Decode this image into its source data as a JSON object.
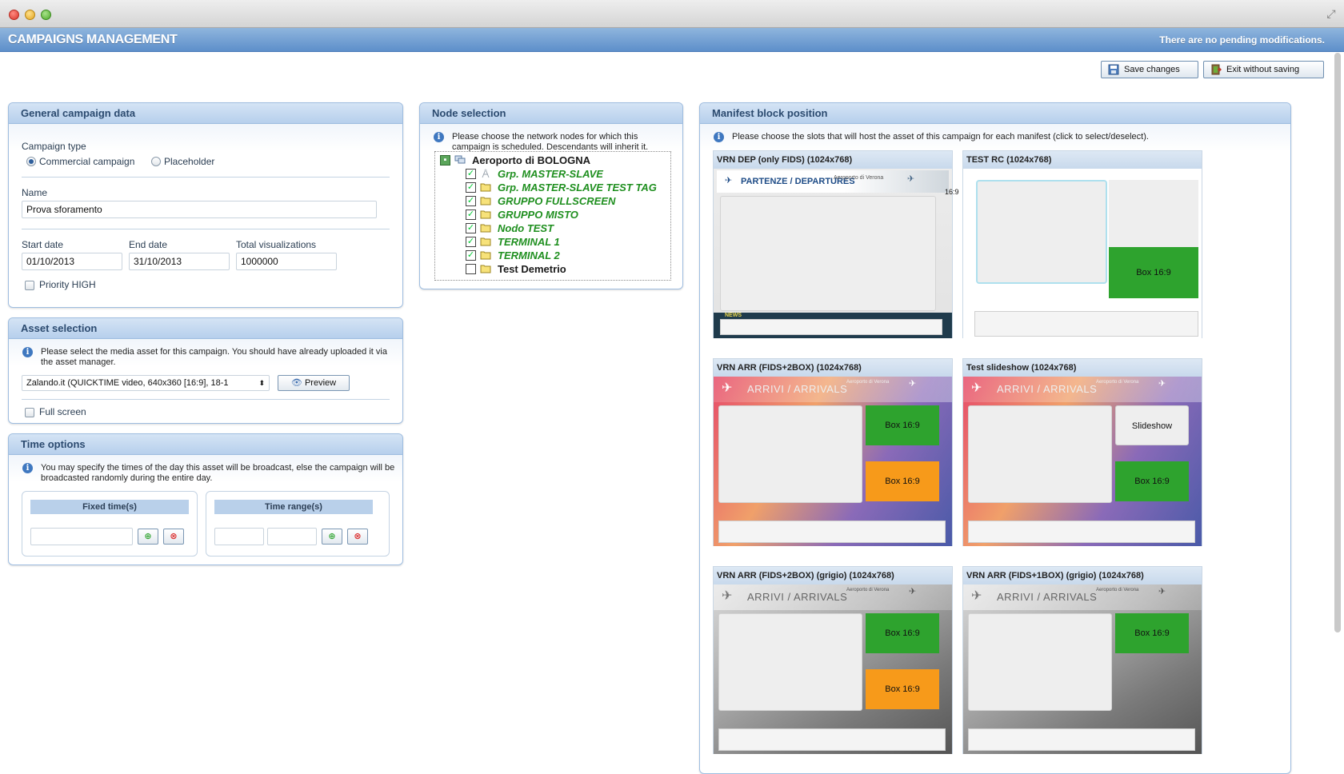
{
  "app": {
    "title": "CAMPAIGNS MANAGEMENT",
    "status": "There are no pending modifications.",
    "save_label": "Save changes",
    "exit_label": "Exit without saving"
  },
  "general": {
    "header": "General campaign data",
    "campaign_type_label": "Campaign type",
    "type_options": [
      "Commercial campaign",
      "Placeholder"
    ],
    "selected_type": "Commercial campaign",
    "name_label": "Name",
    "name_value": "Prova sforamento",
    "start_label": "Start date",
    "start_value": "01/10/2013",
    "end_label": "End date",
    "end_value": "31/10/2013",
    "total_label": "Total visualizations",
    "total_value": "1000000",
    "priority_label": "Priority HIGH"
  },
  "asset": {
    "header": "Asset selection",
    "info": "Please select the media asset for this campaign. You should have already uploaded it via the asset manager.",
    "selected": "Zalando.it (QUICKTIME video, 640x360 [16:9], 18-1",
    "preview_label": "Preview",
    "fullscreen_label": "Full screen"
  },
  "time": {
    "header": "Time options",
    "info": "You may specify the times of the day this asset will be broadcast, else the campaign will be broadcasted randomly during the entire day.",
    "fixed_label": "Fixed time(s)",
    "range_label": "Time range(s)"
  },
  "nodes": {
    "header": "Node selection",
    "info": "Please choose the network nodes for which this campaign is scheduled. Descendants will inherit it.",
    "root": "Aeroporto di BOLOGNA",
    "items": [
      {
        "label": "Grp. MASTER-SLAVE",
        "checked": true
      },
      {
        "label": "Grp. MASTER-SLAVE TEST TAG",
        "checked": true
      },
      {
        "label": "GRUPPO FULLSCREEN",
        "checked": true
      },
      {
        "label": "GRUPPO MISTO",
        "checked": true
      },
      {
        "label": "Nodo TEST",
        "checked": true
      },
      {
        "label": "TERMINAL 1",
        "checked": true
      },
      {
        "label": "TERMINAL 2",
        "checked": true
      },
      {
        "label": "Test Demetrio",
        "checked": false
      }
    ]
  },
  "manifest": {
    "header": "Manifest block position",
    "info": "Please choose the slots that will host the asset of this campaign for each manifest (click to select/deselect).",
    "cards": [
      {
        "title": "VRN DEP (only FIDS) (1024x768)",
        "banner": "PARTENZE / DEPARTURES",
        "logo": "Aeroporto di Verona",
        "side_label": "16:9",
        "ticker_label": "NEWS"
      },
      {
        "title": "TEST RC (1024x768)",
        "box1": "Box 16:9"
      },
      {
        "title": "VRN ARR (FIDS+2BOX) (1024x768)",
        "banner": "ARRIVI / ARRIVALS",
        "logo": "Aeroporto di Verona",
        "box1": "Box 16:9",
        "box2": "Box 16:9"
      },
      {
        "title": "Test slideshow (1024x768)",
        "banner": "ARRIVI / ARRIVALS",
        "logo": "Aeroporto di Verona",
        "box1": "Slideshow",
        "box2": "Box 16:9"
      },
      {
        "title": "VRN ARR (FIDS+2BOX) (grigio) (1024x768)",
        "banner": "ARRIVI / ARRIVALS",
        "logo": "Aeroporto di Verona",
        "box1": "Box 16:9",
        "box2": "Box 16:9"
      },
      {
        "title": "VRN ARR (FIDS+1BOX) (grigio) (1024x768)",
        "banner": "ARRIVI / ARRIVALS",
        "logo": "Aeroporto di Verona",
        "box1": "Box 16:9"
      }
    ]
  },
  "colors": {
    "header_blue": "#6a9bd1",
    "slot_green": "#2ea32e",
    "slot_orange": "#f79a1a",
    "node_green": "#1f8f1f"
  }
}
